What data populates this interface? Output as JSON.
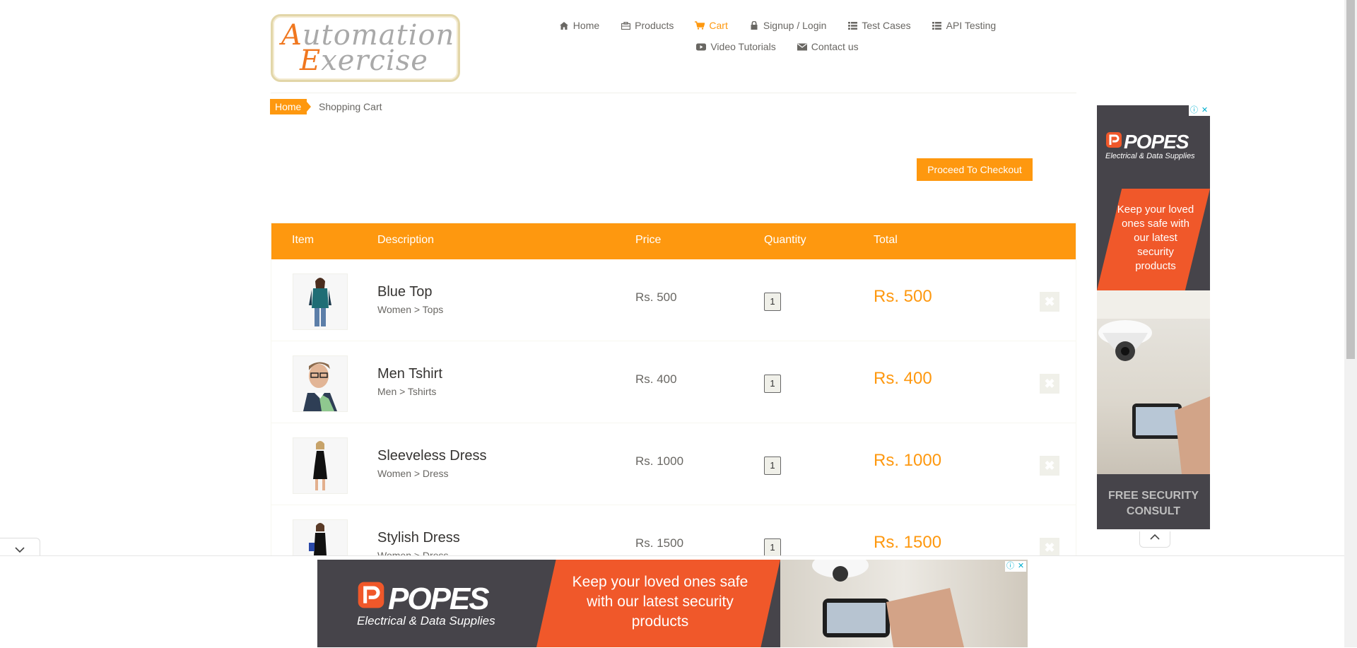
{
  "logo": {
    "line1_cap": "A",
    "line1_rest": "utomation",
    "line2_cap": "E",
    "line2_rest": "xercise"
  },
  "nav": [
    {
      "label": "Home",
      "icon": "home-icon"
    },
    {
      "label": "Products",
      "icon": "products-icon"
    },
    {
      "label": "Cart",
      "icon": "cart-icon",
      "active": true
    },
    {
      "label": "Signup / Login",
      "icon": "lock-icon"
    },
    {
      "label": "Test Cases",
      "icon": "list-icon"
    },
    {
      "label": "API Testing",
      "icon": "list-icon"
    },
    {
      "label": "Video Tutorials",
      "icon": "youtube-icon"
    },
    {
      "label": "Contact us",
      "icon": "envelope-icon"
    }
  ],
  "breadcrumb": {
    "home": "Home",
    "current": "Shopping Cart"
  },
  "checkout": {
    "label": "Proceed To Checkout"
  },
  "cart": {
    "headers": {
      "item": "Item",
      "description": "Description",
      "price": "Price",
      "quantity": "Quantity",
      "total": "Total"
    },
    "rows": [
      {
        "name": "Blue Top",
        "category": "Women > Tops",
        "price": "Rs. 500",
        "quantity": "1",
        "total": "Rs. 500"
      },
      {
        "name": "Men Tshirt",
        "category": "Men > Tshirts",
        "price": "Rs. 400",
        "quantity": "1",
        "total": "Rs. 400"
      },
      {
        "name": "Sleeveless Dress",
        "category": "Women > Dress",
        "price": "Rs. 1000",
        "quantity": "1",
        "total": "Rs. 1000"
      },
      {
        "name": "Stylish Dress",
        "category": "Women > Dress",
        "price": "Rs. 1500",
        "quantity": "1",
        "total": "Rs. 1500"
      }
    ],
    "delete_glyph": "✖"
  },
  "ad_side": {
    "brand": "POPES",
    "tagline": "Electrical & Data Supplies",
    "message": "Keep your loved ones safe with our latest security products",
    "cta": "FREE SECURITY CONSULT"
  },
  "ad_bottom": {
    "brand": "POPES",
    "tagline": "Electrical & Data Supplies",
    "message": "Keep your loved ones safe with our latest security products"
  },
  "ad_badge": {
    "info": "ⓘ",
    "close": "✕"
  },
  "colors": {
    "accent": "#fe980f",
    "ad_dark": "#46444a",
    "ad_orange": "#f0582a"
  }
}
